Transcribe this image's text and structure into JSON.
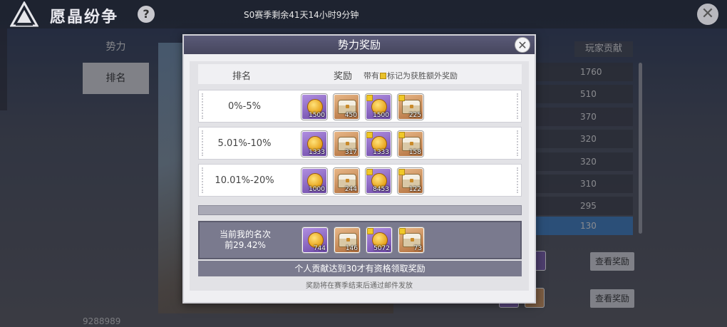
{
  "app": {
    "title": "愿晶纷争",
    "help": "?",
    "season_text": "S0赛季剩余41天14小时9分钟",
    "close": "✕"
  },
  "tabs": [
    {
      "label": "势力"
    },
    {
      "label": "排名"
    }
  ],
  "player_id": "9288989",
  "ranking_bg": {
    "header": "玩家贡献",
    "values": [
      "1760",
      "510",
      "370",
      "320",
      "320",
      "310",
      "295",
      "130"
    ],
    "view_button": "查看奖励"
  },
  "modal": {
    "title": "势力奖励",
    "close": "✕",
    "header": {
      "rank": "排名",
      "reward": "奖励",
      "note_pre": "带有",
      "note_post": "标记为获胜额外奖励"
    },
    "rows": [
      {
        "label": "0%-5%",
        "items": [
          {
            "type": "coin",
            "bg": "purple",
            "qty": "1500",
            "flag": false
          },
          {
            "type": "chest",
            "bg": "orange",
            "qty": "450",
            "flag": false
          },
          {
            "type": "coin",
            "bg": "purple",
            "qty": "1500",
            "flag": true
          },
          {
            "type": "chest",
            "bg": "orange",
            "qty": "225",
            "flag": true
          }
        ]
      },
      {
        "label": "5.01%-10%",
        "items": [
          {
            "type": "coin",
            "bg": "purple",
            "qty": "1333",
            "flag": false
          },
          {
            "type": "chest",
            "bg": "orange",
            "qty": "317",
            "flag": false
          },
          {
            "type": "coin",
            "bg": "purple",
            "qty": "1333",
            "flag": true
          },
          {
            "type": "chest",
            "bg": "orange",
            "qty": "158",
            "flag": true
          }
        ]
      },
      {
        "label": "10.01%-20%",
        "items": [
          {
            "type": "coin",
            "bg": "purple",
            "qty": "1000",
            "flag": false
          },
          {
            "type": "chest",
            "bg": "orange",
            "qty": "244",
            "flag": false
          },
          {
            "type": "coin",
            "bg": "purple",
            "qty": "8453",
            "flag": true
          },
          {
            "type": "chest",
            "bg": "orange",
            "qty": "122",
            "flag": true
          }
        ]
      }
    ],
    "my_rank": {
      "label": "当前我的名次",
      "value": "前29.42%",
      "items": [
        {
          "type": "coin",
          "bg": "purple",
          "qty": "744",
          "flag": false
        },
        {
          "type": "chest",
          "bg": "orange",
          "qty": "146",
          "flag": false
        },
        {
          "type": "coin",
          "bg": "purple",
          "qty": "5072",
          "flag": true
        },
        {
          "type": "chest",
          "bg": "orange",
          "qty": "73",
          "flag": true
        }
      ]
    },
    "notice": "个人贡献达到30才有资格领取奖励",
    "footer": "奖励将在赛季结束后通过邮件发放"
  },
  "colors": {
    "accent_blue": "#3f7fc2",
    "modal_header": "#4f4f6a",
    "item_purple": "#8e6cc8",
    "item_orange": "#cf9560",
    "win_flag": "#f0c828"
  },
  "icons": [
    "app-emblem-icon",
    "help-icon",
    "close-icon",
    "coin-icon",
    "chest-icon",
    "win-flag-icon"
  ]
}
